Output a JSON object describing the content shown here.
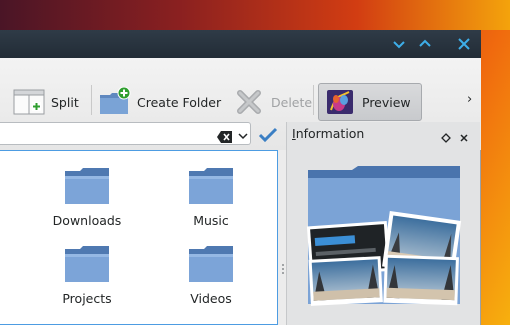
{
  "toolbar": {
    "split_label": "Split",
    "create_folder_label": "Create Folder",
    "delete_label": "Delete",
    "preview_label": "Preview",
    "more_label": "›"
  },
  "places_view": {
    "items": [
      {
        "label": "Downloads"
      },
      {
        "label": "Music"
      },
      {
        "label": "Projects"
      },
      {
        "label": "Videos"
      }
    ]
  },
  "info_panel": {
    "title_accel": "I",
    "title_rest": "nformation"
  },
  "colors": {
    "accent": "#4d9ce2",
    "titlebar": "#2a3440",
    "folder": "#6d94c8"
  }
}
